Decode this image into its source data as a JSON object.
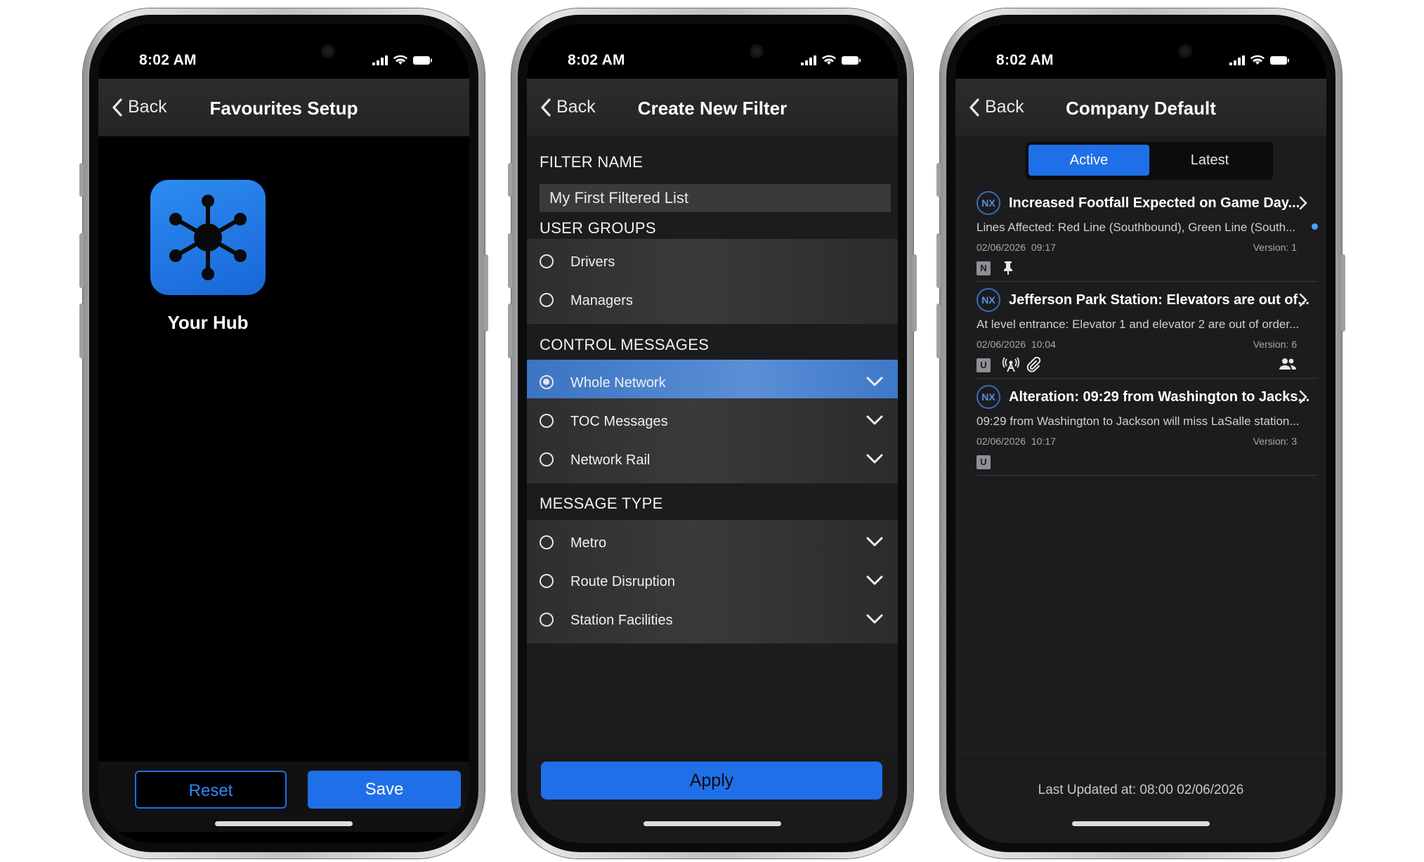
{
  "status": {
    "time": "8:02 AM"
  },
  "common": {
    "back_label": "Back"
  },
  "screen1": {
    "title": "Favourites Setup",
    "hub_label": "Your Hub",
    "reset_label": "Reset",
    "save_label": "Save"
  },
  "screen2": {
    "title": "Create New Filter",
    "filter_name_heading": "FILTER NAME",
    "filter_name_value": "My First Filtered List",
    "user_groups_heading": "USER GROUPS",
    "user_groups": [
      "Drivers",
      "Managers"
    ],
    "control_messages_heading": "CONTROL MESSAGES",
    "control_messages": [
      "Whole Network",
      "TOC Messages",
      "Network Rail"
    ],
    "control_selected": "Whole Network",
    "message_type_heading": "MESSAGE TYPE",
    "message_types": [
      "Metro",
      "Route Disruption",
      "Station Facilities"
    ],
    "apply_label": "Apply"
  },
  "screen3": {
    "title": "Company Default",
    "segments": [
      "Active",
      "Latest"
    ],
    "active_segment": "Active",
    "messages": [
      {
        "badge": "NX",
        "title": "Increased Footfall Expected on Game Day...",
        "body": "Lines Affected: Red Line (Southbound), Green Line (South...",
        "date": "02/06/2026",
        "time": "09:17",
        "version": "Version: 1",
        "tag": "N",
        "icons": [
          "pin-icon"
        ],
        "unread": true
      },
      {
        "badge": "NX",
        "title": "Jefferson Park Station: Elevators are out of...",
        "body": "At level entrance: Elevator 1 and elevator 2 are out of order...",
        "date": "02/06/2026",
        "time": "10:04",
        "version": "Version: 6",
        "tag": "U",
        "icons": [
          "broadcast-icon",
          "attachment-icon",
          "group-icon"
        ],
        "unread": false
      },
      {
        "badge": "NX",
        "title": "Alteration: 09:29 from Washington to Jacks...",
        "body": "09:29 from Washington to Jackson will miss LaSalle station...",
        "date": "02/06/2026",
        "time": "10:17",
        "version": "Version: 3",
        "tag": "U",
        "icons": [],
        "unread": false
      }
    ],
    "last_updated": "Last Updated at: 08:00 02/06/2026"
  },
  "colors": {
    "accent": "#1f70e8",
    "selected_row": "#4a84cf",
    "background": "#1c1c1e"
  }
}
